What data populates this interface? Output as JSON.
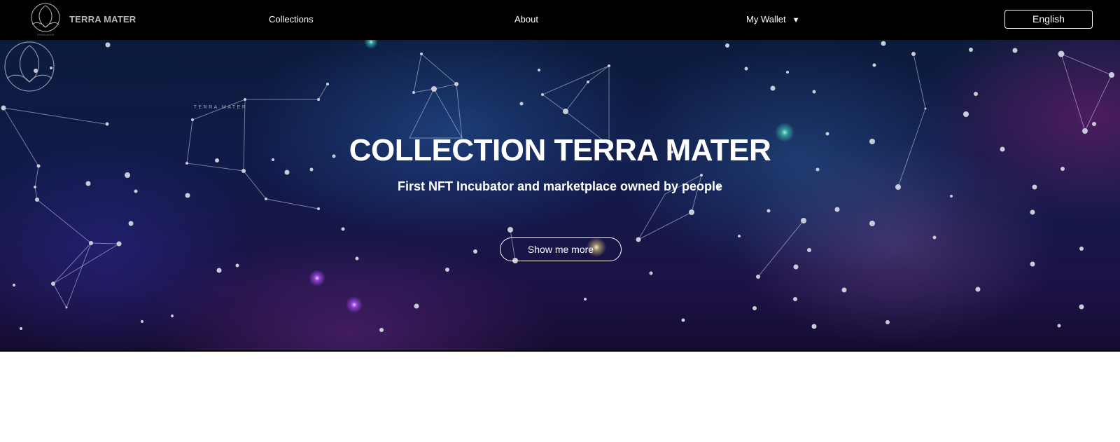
{
  "nav": {
    "brand": "TERRA MATER",
    "logo_text": "TERRA MATER",
    "links": [
      "Collections",
      "About"
    ],
    "wallet_label": "My Wallet",
    "wallet_arrow": "▼",
    "language": "English"
  },
  "hero": {
    "logo_text": "TERRA MATER",
    "title": "COLLECTION TERRA MATER",
    "subtitle": "First NFT Incubator and marketplace owned by people",
    "button": "Show me more"
  },
  "colors": {
    "nav_bg": "#000000",
    "brand_text": "#b9b9b9",
    "hero_deep": "#121a4a",
    "hero_purple": "#6e1e6e",
    "accent_glow_teal": "#5fd3c8",
    "accent_glow_violet": "#c46cff"
  },
  "icons": {
    "logo": "terra-mater-leaf-logo",
    "wallet_dropdown": "triangle-down-icon"
  }
}
